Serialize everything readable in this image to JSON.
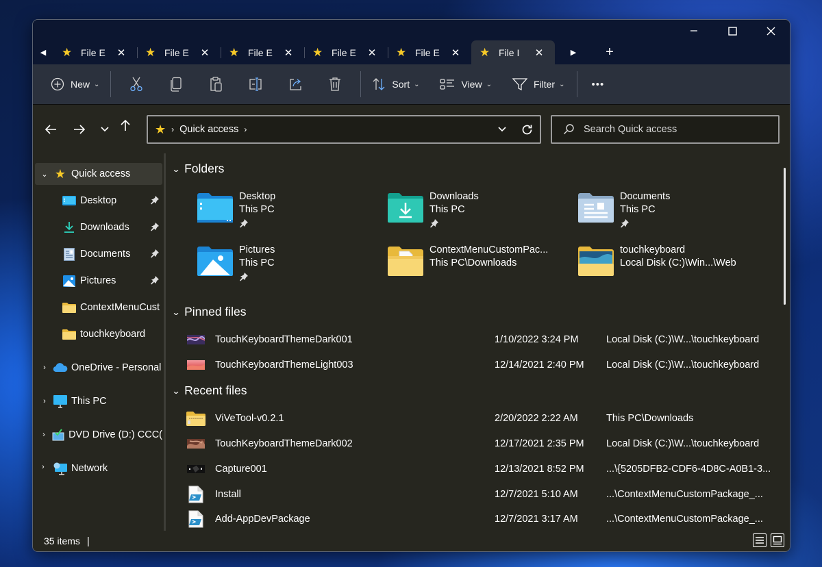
{
  "window": {
    "tabs": [
      {
        "label": "File Explorer",
        "short": "File E",
        "active": false
      },
      {
        "label": "File Explorer",
        "short": "File E",
        "active": false
      },
      {
        "label": "File Explorer",
        "short": "File E",
        "active": false
      },
      {
        "label": "File Explorer",
        "short": "File E",
        "active": false
      },
      {
        "label": "File Explorer",
        "short": "File E",
        "active": false
      },
      {
        "label": "File Explorer",
        "short": "File I",
        "active": true
      }
    ],
    "controls": {
      "minimize": "minimize-icon",
      "maximize": "maximize-icon",
      "close": "close-icon"
    }
  },
  "commandbar": {
    "new_label": "New",
    "icons": [
      "cut-icon",
      "copy-icon",
      "paste-icon",
      "rename-icon",
      "share-icon",
      "delete-icon"
    ],
    "sort_label": "Sort",
    "view_label": "View",
    "filter_label": "Filter",
    "more_label": "•••"
  },
  "address": {
    "crumbs": [
      "Quick access"
    ],
    "search_placeholder": "Search Quick access"
  },
  "sidebar": {
    "quick_access": "Quick access",
    "pinned": [
      {
        "label": "Desktop",
        "icon": "desktop-folder-icon",
        "pinned": true
      },
      {
        "label": "Downloads",
        "icon": "downloads-icon",
        "pinned": true
      },
      {
        "label": "Documents",
        "icon": "documents-icon",
        "pinned": true
      },
      {
        "label": "Pictures",
        "icon": "pictures-icon",
        "pinned": true
      },
      {
        "label": "ContextMenuCust",
        "icon": "folder-icon",
        "pinned": false
      },
      {
        "label": "touchkeyboard",
        "icon": "folder-icon",
        "pinned": false
      }
    ],
    "roots": [
      {
        "label": "OneDrive - Personal",
        "icon": "onedrive-icon"
      },
      {
        "label": "This PC",
        "icon": "this-pc-icon"
      },
      {
        "label": "DVD Drive (D:) CCCOMA",
        "display": "DVD Drive (D:) CCC(",
        "icon": "dvd-drive-icon"
      },
      {
        "label": "Network",
        "icon": "network-icon"
      }
    ]
  },
  "main": {
    "folders_heading": "Folders",
    "folders": [
      {
        "name": "Desktop",
        "location": "This PC",
        "pinned": true
      },
      {
        "name": "Downloads",
        "location": "This PC",
        "pinned": true
      },
      {
        "name": "Documents",
        "location": "This PC",
        "pinned": true
      },
      {
        "name": "Pictures",
        "location": "This PC",
        "pinned": true
      },
      {
        "name": "ContextMenuCustomPac...",
        "location": "This PC\\Downloads",
        "pinned": false
      },
      {
        "name": "touchkeyboard",
        "location": "Local Disk (C:)\\Win...\\Web",
        "pinned": false
      }
    ],
    "pinned_heading": "Pinned files",
    "pinned_files": [
      {
        "name": "TouchKeyboardThemeDark001",
        "date": "1/10/2022 3:24 PM",
        "location": "Local Disk (C:)\\W...\\touchkeyboard"
      },
      {
        "name": "TouchKeyboardThemeLight003",
        "date": "12/14/2021 2:40 PM",
        "location": "Local Disk (C:)\\W...\\touchkeyboard"
      }
    ],
    "recent_heading": "Recent files",
    "recent_files": [
      {
        "name": "ViVeTool-v0.2.1",
        "date": "2/20/2022 2:22 AM",
        "location": "This PC\\Downloads"
      },
      {
        "name": "TouchKeyboardThemeDark002",
        "date": "12/17/2021 2:35 PM",
        "location": "Local Disk (C:)\\W...\\touchkeyboard"
      },
      {
        "name": "Capture001",
        "date": "12/13/2021 8:52 PM",
        "location": "...\\{5205DFB2-CDF6-4D8C-A0B1-3..."
      },
      {
        "name": "Install",
        "date": "12/7/2021 5:10 AM",
        "location": "...\\ContextMenuCustomPackage_..."
      },
      {
        "name": "Add-AppDevPackage",
        "date": "12/7/2021 3:17 AM",
        "location": "...\\ContextMenuCustomPackage_..."
      }
    ]
  },
  "status": {
    "items_count": "35 items",
    "separator": "|"
  },
  "colors": {
    "accent_star": "#f6c928",
    "titlebar": "#0c1630",
    "commandbar": "#2b313d",
    "background": "#26261f"
  }
}
